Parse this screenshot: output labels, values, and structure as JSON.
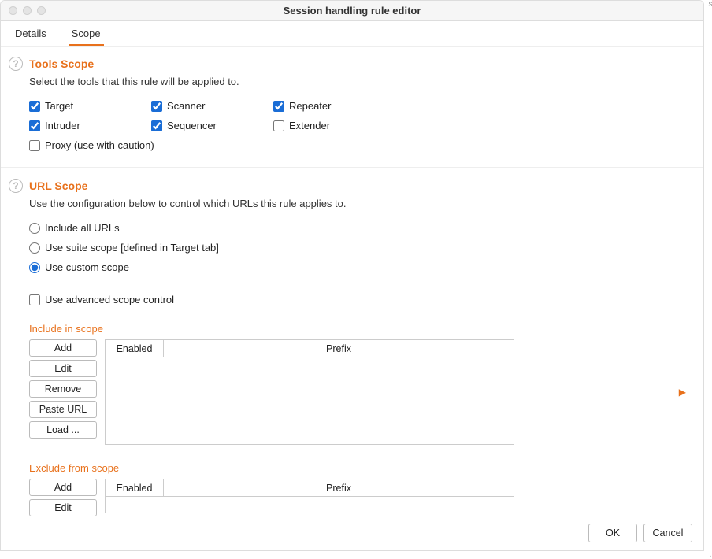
{
  "window": {
    "title": "Session handling rule editor"
  },
  "tabs": [
    {
      "label": "Details",
      "active": false
    },
    {
      "label": "Scope",
      "active": true
    }
  ],
  "tools_scope": {
    "title": "Tools Scope",
    "desc": "Select the tools that this rule will be applied to.",
    "tools": [
      {
        "label": "Target",
        "checked": true
      },
      {
        "label": "Scanner",
        "checked": true
      },
      {
        "label": "Repeater",
        "checked": true
      },
      {
        "label": "Intruder",
        "checked": true
      },
      {
        "label": "Sequencer",
        "checked": true
      },
      {
        "label": "Extender",
        "checked": false
      },
      {
        "label": "Proxy (use with caution)",
        "checked": false
      }
    ]
  },
  "url_scope": {
    "title": "URL Scope",
    "desc": "Use the configuration below to control which URLs this rule applies to.",
    "options": [
      {
        "label": "Include all URLs",
        "selected": false
      },
      {
        "label": "Use suite scope [defined in Target tab]",
        "selected": false
      },
      {
        "label": "Use custom scope",
        "selected": true
      }
    ],
    "advanced_label": "Use advanced scope control",
    "advanced_checked": false,
    "include": {
      "title": "Include in scope",
      "rows": []
    },
    "exclude": {
      "title": "Exclude from scope",
      "rows": []
    }
  },
  "table": {
    "columns": [
      "Enabled",
      "Prefix"
    ]
  },
  "buttons": {
    "add": "Add",
    "edit": "Edit",
    "remove": "Remove",
    "paste_url": "Paste URL",
    "load": "Load ..."
  },
  "footer": {
    "ok": "OK",
    "cancel": "Cancel"
  },
  "colors": {
    "accent": "#e8711c",
    "checkbox": "#1a6dd6"
  }
}
